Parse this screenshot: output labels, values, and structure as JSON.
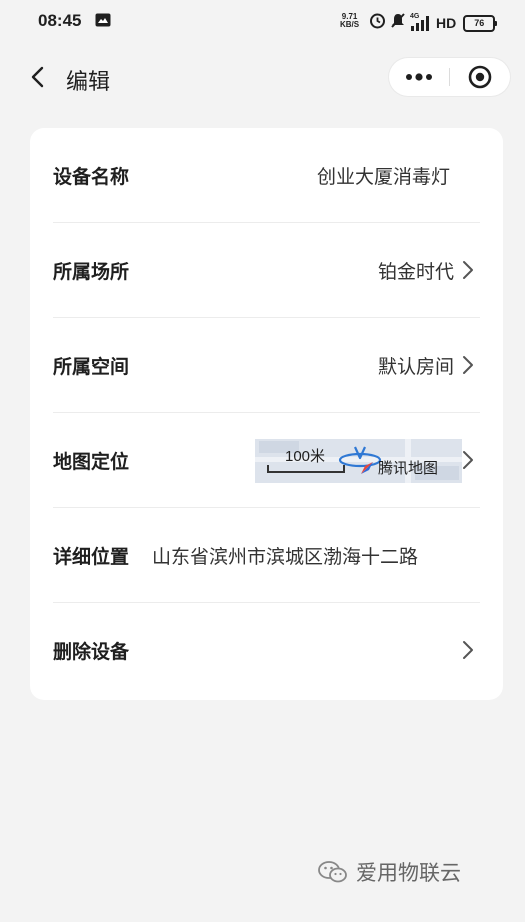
{
  "status_bar": {
    "time": "08:45",
    "net_speed_value": "9.71",
    "net_speed_unit": "KB/S",
    "network_type": "4G",
    "hd_label": "HD",
    "battery": "76"
  },
  "nav": {
    "title": "编辑"
  },
  "rows": [
    {
      "label": "设备名称",
      "value": "创业大厦消毒灯"
    },
    {
      "label": "所属场所",
      "value": "铂金时代"
    },
    {
      "label": "所属空间",
      "value": "默认房间"
    },
    {
      "label": "地图定位"
    },
    {
      "label": "详细位置",
      "value": "山东省滨州市滨城区渤海十二路"
    },
    {
      "label": "删除设备"
    }
  ],
  "map": {
    "scale_label": "100米",
    "brand": "腾讯地图"
  },
  "watermark": {
    "text": "爱用物联云"
  }
}
